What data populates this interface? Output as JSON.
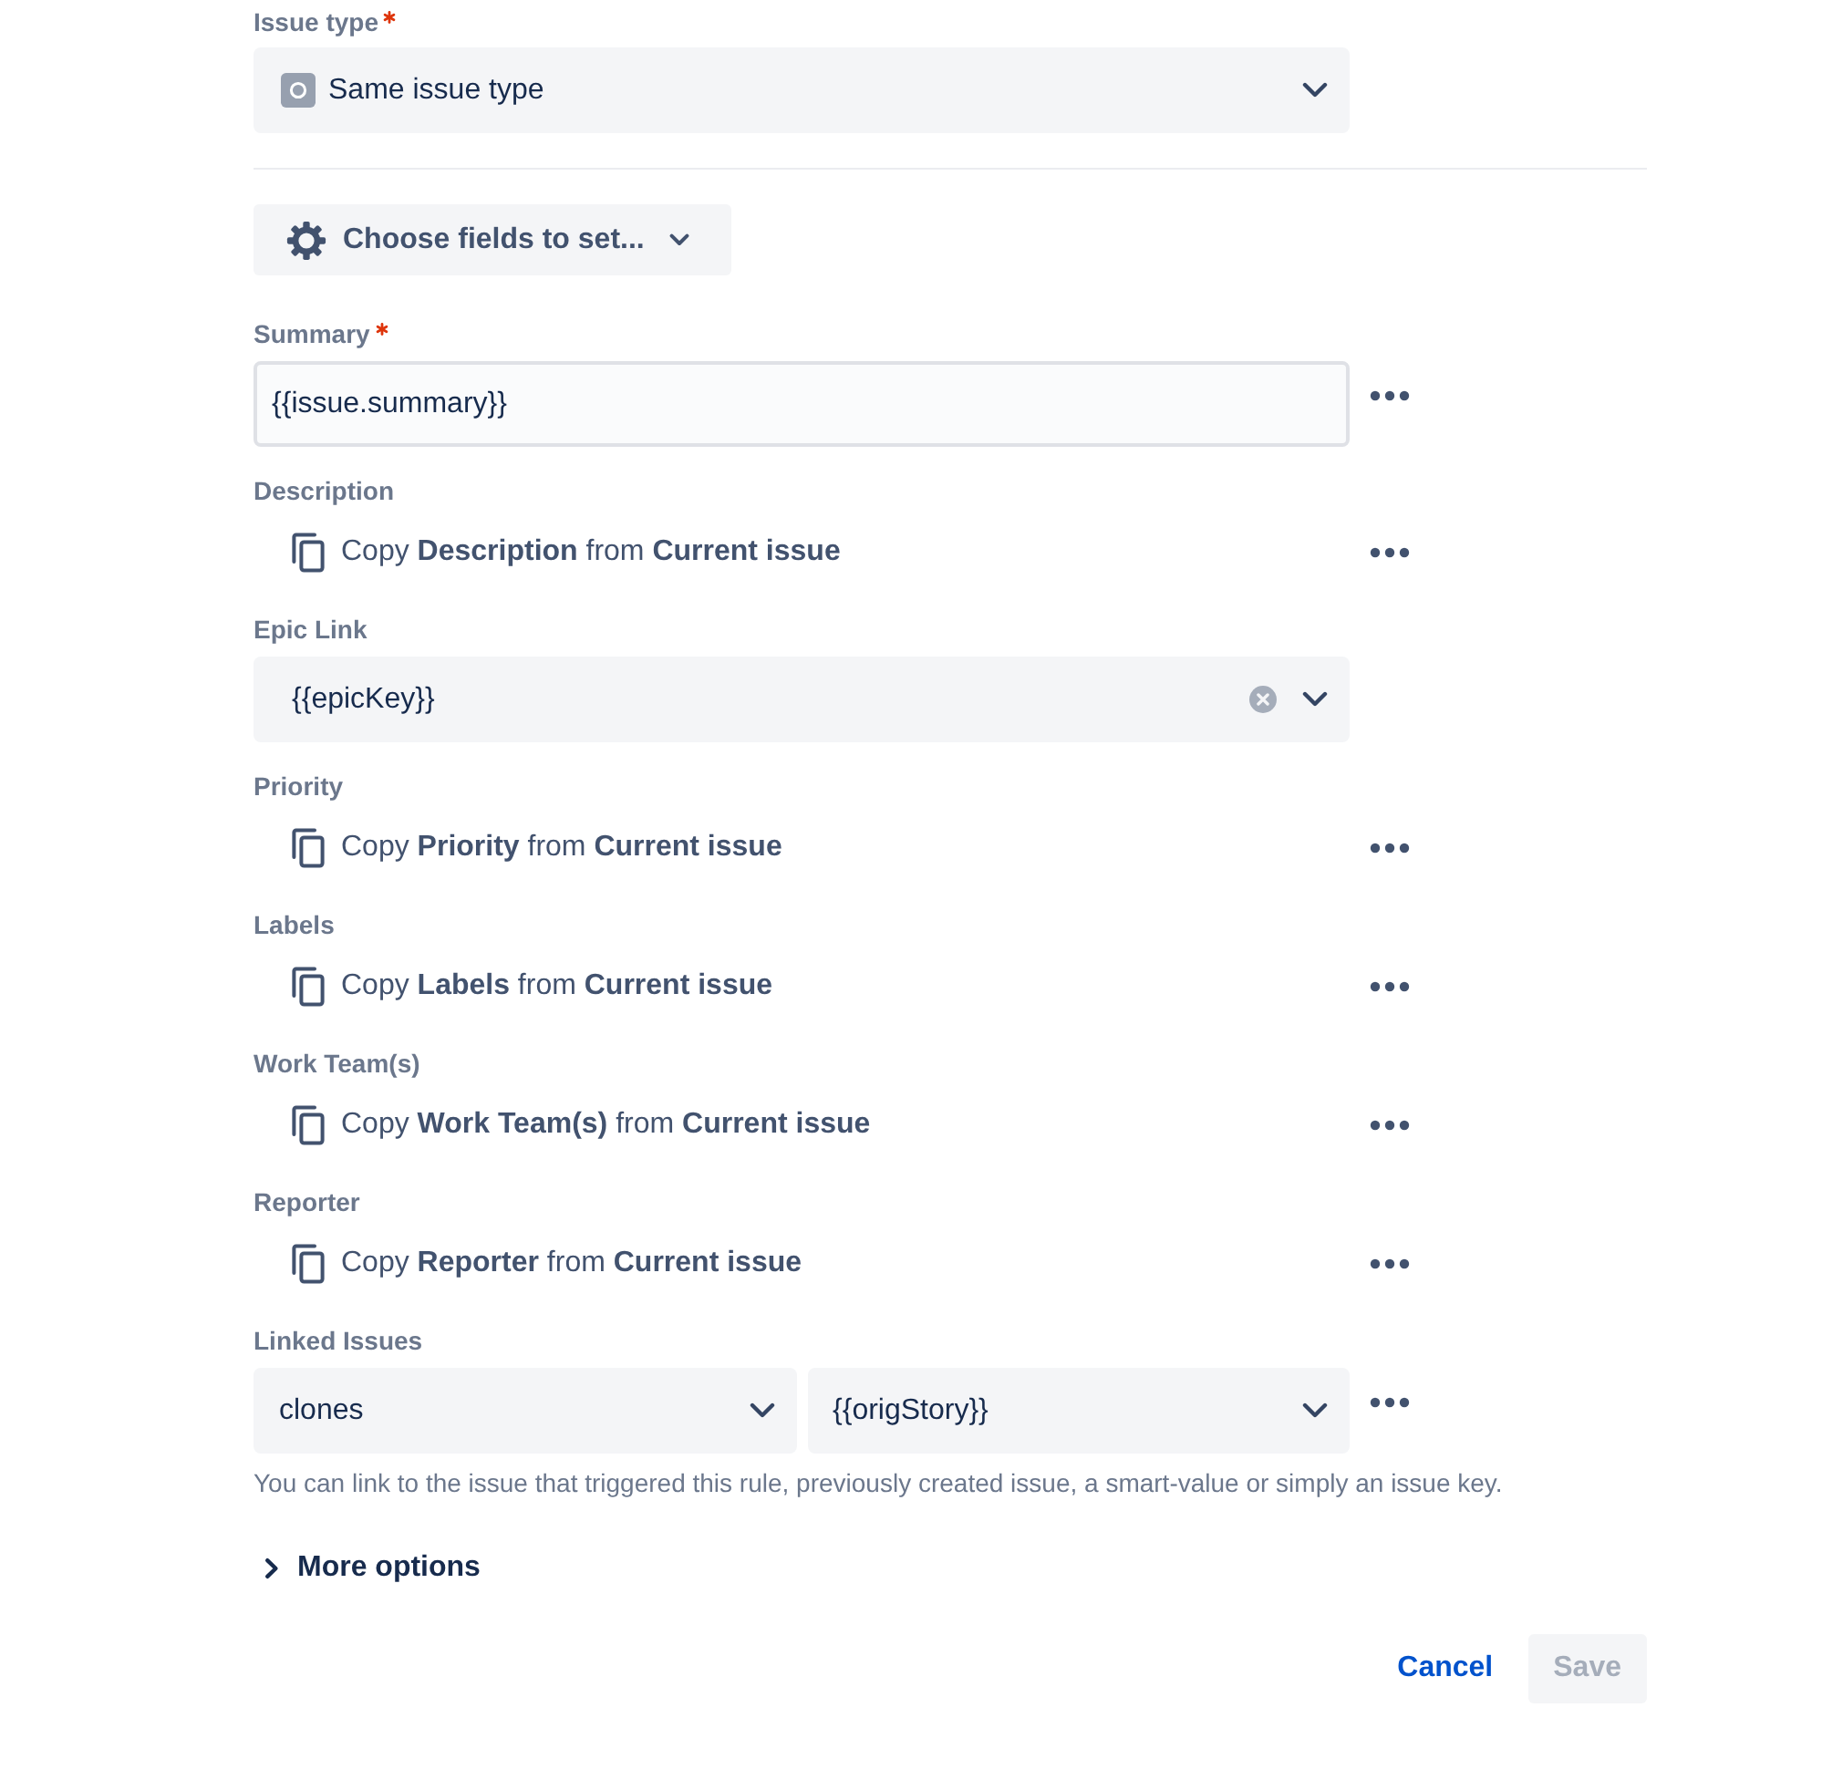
{
  "issue_type": {
    "label": "Issue type",
    "required": true,
    "value": "Same issue type"
  },
  "choose_fields_button": {
    "label": "Choose fields to set..."
  },
  "fields": [
    {
      "kind": "text",
      "label": "Summary",
      "required": true,
      "value": "{{issue.summary}}",
      "menu": true
    },
    {
      "kind": "copy",
      "label": "Description",
      "required": false,
      "text": "Copy **Description** from **Current issue**",
      "menu": true
    },
    {
      "kind": "select",
      "label": "Epic Link",
      "required": false,
      "value": "{{epicKey}}",
      "clearable": true,
      "menu": false
    },
    {
      "kind": "copy",
      "label": "Priority",
      "required": false,
      "text": "Copy **Priority** from **Current issue**",
      "menu": true
    },
    {
      "kind": "copy",
      "label": "Labels",
      "required": false,
      "text": "Copy **Labels** from **Current issue**",
      "menu": true
    },
    {
      "kind": "copy",
      "label": "Work Team(s)",
      "required": false,
      "text": "Copy **Work Team(s)** from **Current issue**",
      "menu": true
    },
    {
      "kind": "copy",
      "label": "Reporter",
      "required": false,
      "text": "Copy **Reporter** from **Current issue**",
      "menu": true
    },
    {
      "kind": "pair",
      "label": "Linked Issues",
      "required": false,
      "values": [
        "clones",
        "{{origStory}}"
      ],
      "help": "You can link to the issue that triggered this rule, previously created issue, a smart-value or simply an issue key.",
      "menu": true
    }
  ],
  "more_options": {
    "label": "More options",
    "expanded": false
  },
  "buttons": [
    {
      "kind": "link",
      "label": "Cancel",
      "disabled": false
    },
    {
      "kind": "primary",
      "label": "Save",
      "disabled": true
    }
  ]
}
